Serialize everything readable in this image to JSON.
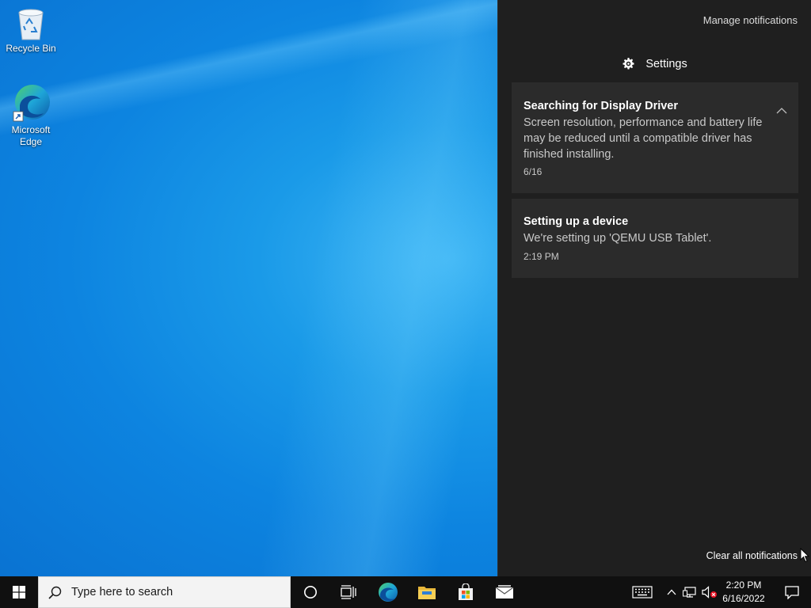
{
  "desktop": {
    "icons": [
      {
        "label": "Recycle Bin",
        "icon": "recycle-bin-icon"
      },
      {
        "label": "Microsoft Edge",
        "icon": "edge-icon"
      }
    ]
  },
  "action_center": {
    "manage_label": "Manage notifications",
    "group_header": "Settings",
    "group_icon": "gear-icon",
    "notifications": [
      {
        "title": "Searching for Display Driver",
        "body": "Screen resolution, performance and battery life may be reduced until a compatible driver has finished installing.",
        "time": "6/16",
        "expanded": true
      },
      {
        "title": "Setting up a device",
        "body": "We're setting up 'QEMU USB Tablet'.",
        "time": "2:19 PM"
      }
    ],
    "clear_all_label": "Clear all notifications"
  },
  "taskbar": {
    "search_placeholder": "Type here to search",
    "pinned": [
      "start-icon",
      "cortana-icon",
      "task-view-icon",
      "edge-icon",
      "file-explorer-icon",
      "store-icon",
      "mail-icon"
    ],
    "tray": {
      "time": "2:20 PM",
      "date": "6/16/2022",
      "icons": [
        "touch-keyboard-icon",
        "chevron-up-icon",
        "network-icon",
        "volume-muted-icon",
        "notification-icon"
      ]
    }
  },
  "colors": {
    "desktop_accent": "#0a84e0",
    "action_center_bg": "#1f1f1f",
    "card_bg": "#2b2b2b",
    "taskbar_bg": "#101010"
  }
}
